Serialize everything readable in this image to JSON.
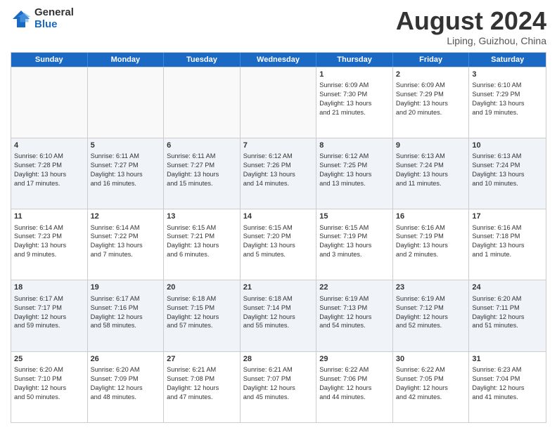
{
  "logo": {
    "general": "General",
    "blue": "Blue"
  },
  "title": "August 2024",
  "location": "Liping, Guizhou, China",
  "days_of_week": [
    "Sunday",
    "Monday",
    "Tuesday",
    "Wednesday",
    "Thursday",
    "Friday",
    "Saturday"
  ],
  "rows": [
    [
      {
        "day": "",
        "text": "",
        "empty": true
      },
      {
        "day": "",
        "text": "",
        "empty": true
      },
      {
        "day": "",
        "text": "",
        "empty": true
      },
      {
        "day": "",
        "text": "",
        "empty": true
      },
      {
        "day": "1",
        "text": "Sunrise: 6:09 AM\nSunset: 7:30 PM\nDaylight: 13 hours\nand 21 minutes.",
        "empty": false
      },
      {
        "day": "2",
        "text": "Sunrise: 6:09 AM\nSunset: 7:29 PM\nDaylight: 13 hours\nand 20 minutes.",
        "empty": false
      },
      {
        "day": "3",
        "text": "Sunrise: 6:10 AM\nSunset: 7:29 PM\nDaylight: 13 hours\nand 19 minutes.",
        "empty": false
      }
    ],
    [
      {
        "day": "4",
        "text": "Sunrise: 6:10 AM\nSunset: 7:28 PM\nDaylight: 13 hours\nand 17 minutes.",
        "empty": false
      },
      {
        "day": "5",
        "text": "Sunrise: 6:11 AM\nSunset: 7:27 PM\nDaylight: 13 hours\nand 16 minutes.",
        "empty": false
      },
      {
        "day": "6",
        "text": "Sunrise: 6:11 AM\nSunset: 7:27 PM\nDaylight: 13 hours\nand 15 minutes.",
        "empty": false
      },
      {
        "day": "7",
        "text": "Sunrise: 6:12 AM\nSunset: 7:26 PM\nDaylight: 13 hours\nand 14 minutes.",
        "empty": false
      },
      {
        "day": "8",
        "text": "Sunrise: 6:12 AM\nSunset: 7:25 PM\nDaylight: 13 hours\nand 13 minutes.",
        "empty": false
      },
      {
        "day": "9",
        "text": "Sunrise: 6:13 AM\nSunset: 7:24 PM\nDaylight: 13 hours\nand 11 minutes.",
        "empty": false
      },
      {
        "day": "10",
        "text": "Sunrise: 6:13 AM\nSunset: 7:24 PM\nDaylight: 13 hours\nand 10 minutes.",
        "empty": false
      }
    ],
    [
      {
        "day": "11",
        "text": "Sunrise: 6:14 AM\nSunset: 7:23 PM\nDaylight: 13 hours\nand 9 minutes.",
        "empty": false
      },
      {
        "day": "12",
        "text": "Sunrise: 6:14 AM\nSunset: 7:22 PM\nDaylight: 13 hours\nand 7 minutes.",
        "empty": false
      },
      {
        "day": "13",
        "text": "Sunrise: 6:15 AM\nSunset: 7:21 PM\nDaylight: 13 hours\nand 6 minutes.",
        "empty": false
      },
      {
        "day": "14",
        "text": "Sunrise: 6:15 AM\nSunset: 7:20 PM\nDaylight: 13 hours\nand 5 minutes.",
        "empty": false
      },
      {
        "day": "15",
        "text": "Sunrise: 6:15 AM\nSunset: 7:19 PM\nDaylight: 13 hours\nand 3 minutes.",
        "empty": false
      },
      {
        "day": "16",
        "text": "Sunrise: 6:16 AM\nSunset: 7:19 PM\nDaylight: 13 hours\nand 2 minutes.",
        "empty": false
      },
      {
        "day": "17",
        "text": "Sunrise: 6:16 AM\nSunset: 7:18 PM\nDaylight: 13 hours\nand 1 minute.",
        "empty": false
      }
    ],
    [
      {
        "day": "18",
        "text": "Sunrise: 6:17 AM\nSunset: 7:17 PM\nDaylight: 12 hours\nand 59 minutes.",
        "empty": false
      },
      {
        "day": "19",
        "text": "Sunrise: 6:17 AM\nSunset: 7:16 PM\nDaylight: 12 hours\nand 58 minutes.",
        "empty": false
      },
      {
        "day": "20",
        "text": "Sunrise: 6:18 AM\nSunset: 7:15 PM\nDaylight: 12 hours\nand 57 minutes.",
        "empty": false
      },
      {
        "day": "21",
        "text": "Sunrise: 6:18 AM\nSunset: 7:14 PM\nDaylight: 12 hours\nand 55 minutes.",
        "empty": false
      },
      {
        "day": "22",
        "text": "Sunrise: 6:19 AM\nSunset: 7:13 PM\nDaylight: 12 hours\nand 54 minutes.",
        "empty": false
      },
      {
        "day": "23",
        "text": "Sunrise: 6:19 AM\nSunset: 7:12 PM\nDaylight: 12 hours\nand 52 minutes.",
        "empty": false
      },
      {
        "day": "24",
        "text": "Sunrise: 6:20 AM\nSunset: 7:11 PM\nDaylight: 12 hours\nand 51 minutes.",
        "empty": false
      }
    ],
    [
      {
        "day": "25",
        "text": "Sunrise: 6:20 AM\nSunset: 7:10 PM\nDaylight: 12 hours\nand 50 minutes.",
        "empty": false
      },
      {
        "day": "26",
        "text": "Sunrise: 6:20 AM\nSunset: 7:09 PM\nDaylight: 12 hours\nand 48 minutes.",
        "empty": false
      },
      {
        "day": "27",
        "text": "Sunrise: 6:21 AM\nSunset: 7:08 PM\nDaylight: 12 hours\nand 47 minutes.",
        "empty": false
      },
      {
        "day": "28",
        "text": "Sunrise: 6:21 AM\nSunset: 7:07 PM\nDaylight: 12 hours\nand 45 minutes.",
        "empty": false
      },
      {
        "day": "29",
        "text": "Sunrise: 6:22 AM\nSunset: 7:06 PM\nDaylight: 12 hours\nand 44 minutes.",
        "empty": false
      },
      {
        "day": "30",
        "text": "Sunrise: 6:22 AM\nSunset: 7:05 PM\nDaylight: 12 hours\nand 42 minutes.",
        "empty": false
      },
      {
        "day": "31",
        "text": "Sunrise: 6:23 AM\nSunset: 7:04 PM\nDaylight: 12 hours\nand 41 minutes.",
        "empty": false
      }
    ]
  ]
}
